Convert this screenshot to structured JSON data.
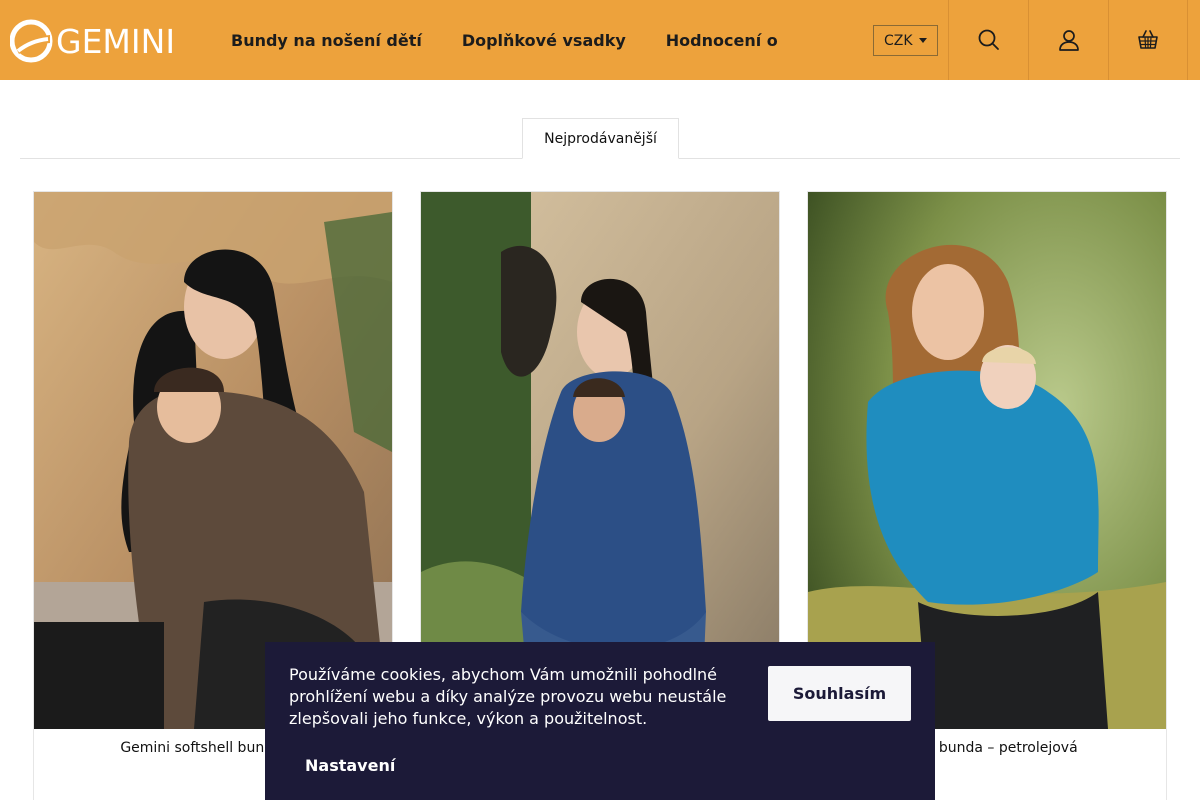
{
  "brand": {
    "name": "GEMINI",
    "accent": "#eda23c",
    "banner_bg": "#1c1a38"
  },
  "nav": {
    "items": [
      {
        "label": "Bundy na nošení dětí"
      },
      {
        "label": "Doplňkové vsadky"
      },
      {
        "label": "Hodnocení o"
      }
    ]
  },
  "header": {
    "currency": "CZK",
    "icons": [
      "search-icon",
      "user-icon",
      "basket-icon"
    ]
  },
  "tabs": [
    {
      "label": "Nejprodávanější"
    }
  ],
  "products": [
    {
      "name": "Gemini softshell bunda – k",
      "image": "woman-brown-jacket-baby-photo"
    },
    {
      "name": "",
      "image": "woman-blue-jacket-baby-photo"
    },
    {
      "name": "tshell bunda – petrolejová",
      "image": "woman-teal-jacket-baby-photo"
    }
  ],
  "cookie": {
    "text": "Používáme cookies, abychom Vám umožnili pohodlné prohlížení webu a díky analýze provozu webu neustále zlepšovali jeho funkce, výkon a použitelnost.",
    "accept": "Souhlasím",
    "settings": "Nastavení"
  }
}
